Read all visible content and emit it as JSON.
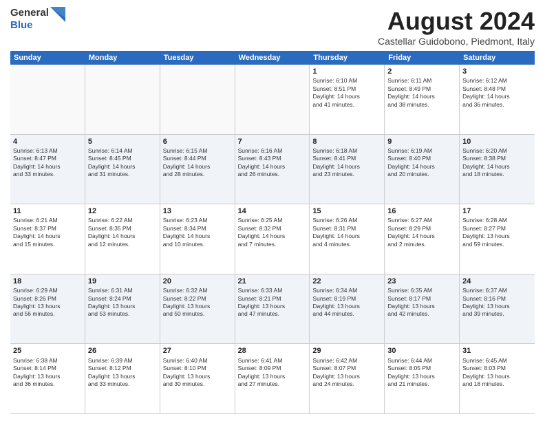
{
  "logo": {
    "general": "General",
    "blue": "Blue"
  },
  "title": "August 2024",
  "location": "Castellar Guidobono, Piedmont, Italy",
  "header_days": [
    "Sunday",
    "Monday",
    "Tuesday",
    "Wednesday",
    "Thursday",
    "Friday",
    "Saturday"
  ],
  "weeks": [
    [
      {
        "day": "",
        "info": ""
      },
      {
        "day": "",
        "info": ""
      },
      {
        "day": "",
        "info": ""
      },
      {
        "day": "",
        "info": ""
      },
      {
        "day": "1",
        "info": "Sunrise: 6:10 AM\nSunset: 8:51 PM\nDaylight: 14 hours\nand 41 minutes."
      },
      {
        "day": "2",
        "info": "Sunrise: 6:11 AM\nSunset: 8:49 PM\nDaylight: 14 hours\nand 38 minutes."
      },
      {
        "day": "3",
        "info": "Sunrise: 6:12 AM\nSunset: 8:48 PM\nDaylight: 14 hours\nand 36 minutes."
      }
    ],
    [
      {
        "day": "4",
        "info": "Sunrise: 6:13 AM\nSunset: 8:47 PM\nDaylight: 14 hours\nand 33 minutes."
      },
      {
        "day": "5",
        "info": "Sunrise: 6:14 AM\nSunset: 8:45 PM\nDaylight: 14 hours\nand 31 minutes."
      },
      {
        "day": "6",
        "info": "Sunrise: 6:15 AM\nSunset: 8:44 PM\nDaylight: 14 hours\nand 28 minutes."
      },
      {
        "day": "7",
        "info": "Sunrise: 6:16 AM\nSunset: 8:43 PM\nDaylight: 14 hours\nand 26 minutes."
      },
      {
        "day": "8",
        "info": "Sunrise: 6:18 AM\nSunset: 8:41 PM\nDaylight: 14 hours\nand 23 minutes."
      },
      {
        "day": "9",
        "info": "Sunrise: 6:19 AM\nSunset: 8:40 PM\nDaylight: 14 hours\nand 20 minutes."
      },
      {
        "day": "10",
        "info": "Sunrise: 6:20 AM\nSunset: 8:38 PM\nDaylight: 14 hours\nand 18 minutes."
      }
    ],
    [
      {
        "day": "11",
        "info": "Sunrise: 6:21 AM\nSunset: 8:37 PM\nDaylight: 14 hours\nand 15 minutes."
      },
      {
        "day": "12",
        "info": "Sunrise: 6:22 AM\nSunset: 8:35 PM\nDaylight: 14 hours\nand 12 minutes."
      },
      {
        "day": "13",
        "info": "Sunrise: 6:23 AM\nSunset: 8:34 PM\nDaylight: 14 hours\nand 10 minutes."
      },
      {
        "day": "14",
        "info": "Sunrise: 6:25 AM\nSunset: 8:32 PM\nDaylight: 14 hours\nand 7 minutes."
      },
      {
        "day": "15",
        "info": "Sunrise: 6:26 AM\nSunset: 8:31 PM\nDaylight: 14 hours\nand 4 minutes."
      },
      {
        "day": "16",
        "info": "Sunrise: 6:27 AM\nSunset: 8:29 PM\nDaylight: 14 hours\nand 2 minutes."
      },
      {
        "day": "17",
        "info": "Sunrise: 6:28 AM\nSunset: 8:27 PM\nDaylight: 13 hours\nand 59 minutes."
      }
    ],
    [
      {
        "day": "18",
        "info": "Sunrise: 6:29 AM\nSunset: 8:26 PM\nDaylight: 13 hours\nand 56 minutes."
      },
      {
        "day": "19",
        "info": "Sunrise: 6:31 AM\nSunset: 8:24 PM\nDaylight: 13 hours\nand 53 minutes."
      },
      {
        "day": "20",
        "info": "Sunrise: 6:32 AM\nSunset: 8:22 PM\nDaylight: 13 hours\nand 50 minutes."
      },
      {
        "day": "21",
        "info": "Sunrise: 6:33 AM\nSunset: 8:21 PM\nDaylight: 13 hours\nand 47 minutes."
      },
      {
        "day": "22",
        "info": "Sunrise: 6:34 AM\nSunset: 8:19 PM\nDaylight: 13 hours\nand 44 minutes."
      },
      {
        "day": "23",
        "info": "Sunrise: 6:35 AM\nSunset: 8:17 PM\nDaylight: 13 hours\nand 42 minutes."
      },
      {
        "day": "24",
        "info": "Sunrise: 6:37 AM\nSunset: 8:16 PM\nDaylight: 13 hours\nand 39 minutes."
      }
    ],
    [
      {
        "day": "25",
        "info": "Sunrise: 6:38 AM\nSunset: 8:14 PM\nDaylight: 13 hours\nand 36 minutes."
      },
      {
        "day": "26",
        "info": "Sunrise: 6:39 AM\nSunset: 8:12 PM\nDaylight: 13 hours\nand 33 minutes."
      },
      {
        "day": "27",
        "info": "Sunrise: 6:40 AM\nSunset: 8:10 PM\nDaylight: 13 hours\nand 30 minutes."
      },
      {
        "day": "28",
        "info": "Sunrise: 6:41 AM\nSunset: 8:09 PM\nDaylight: 13 hours\nand 27 minutes."
      },
      {
        "day": "29",
        "info": "Sunrise: 6:42 AM\nSunset: 8:07 PM\nDaylight: 13 hours\nand 24 minutes."
      },
      {
        "day": "30",
        "info": "Sunrise: 6:44 AM\nSunset: 8:05 PM\nDaylight: 13 hours\nand 21 minutes."
      },
      {
        "day": "31",
        "info": "Sunrise: 6:45 AM\nSunset: 8:03 PM\nDaylight: 13 hours\nand 18 minutes."
      }
    ]
  ]
}
